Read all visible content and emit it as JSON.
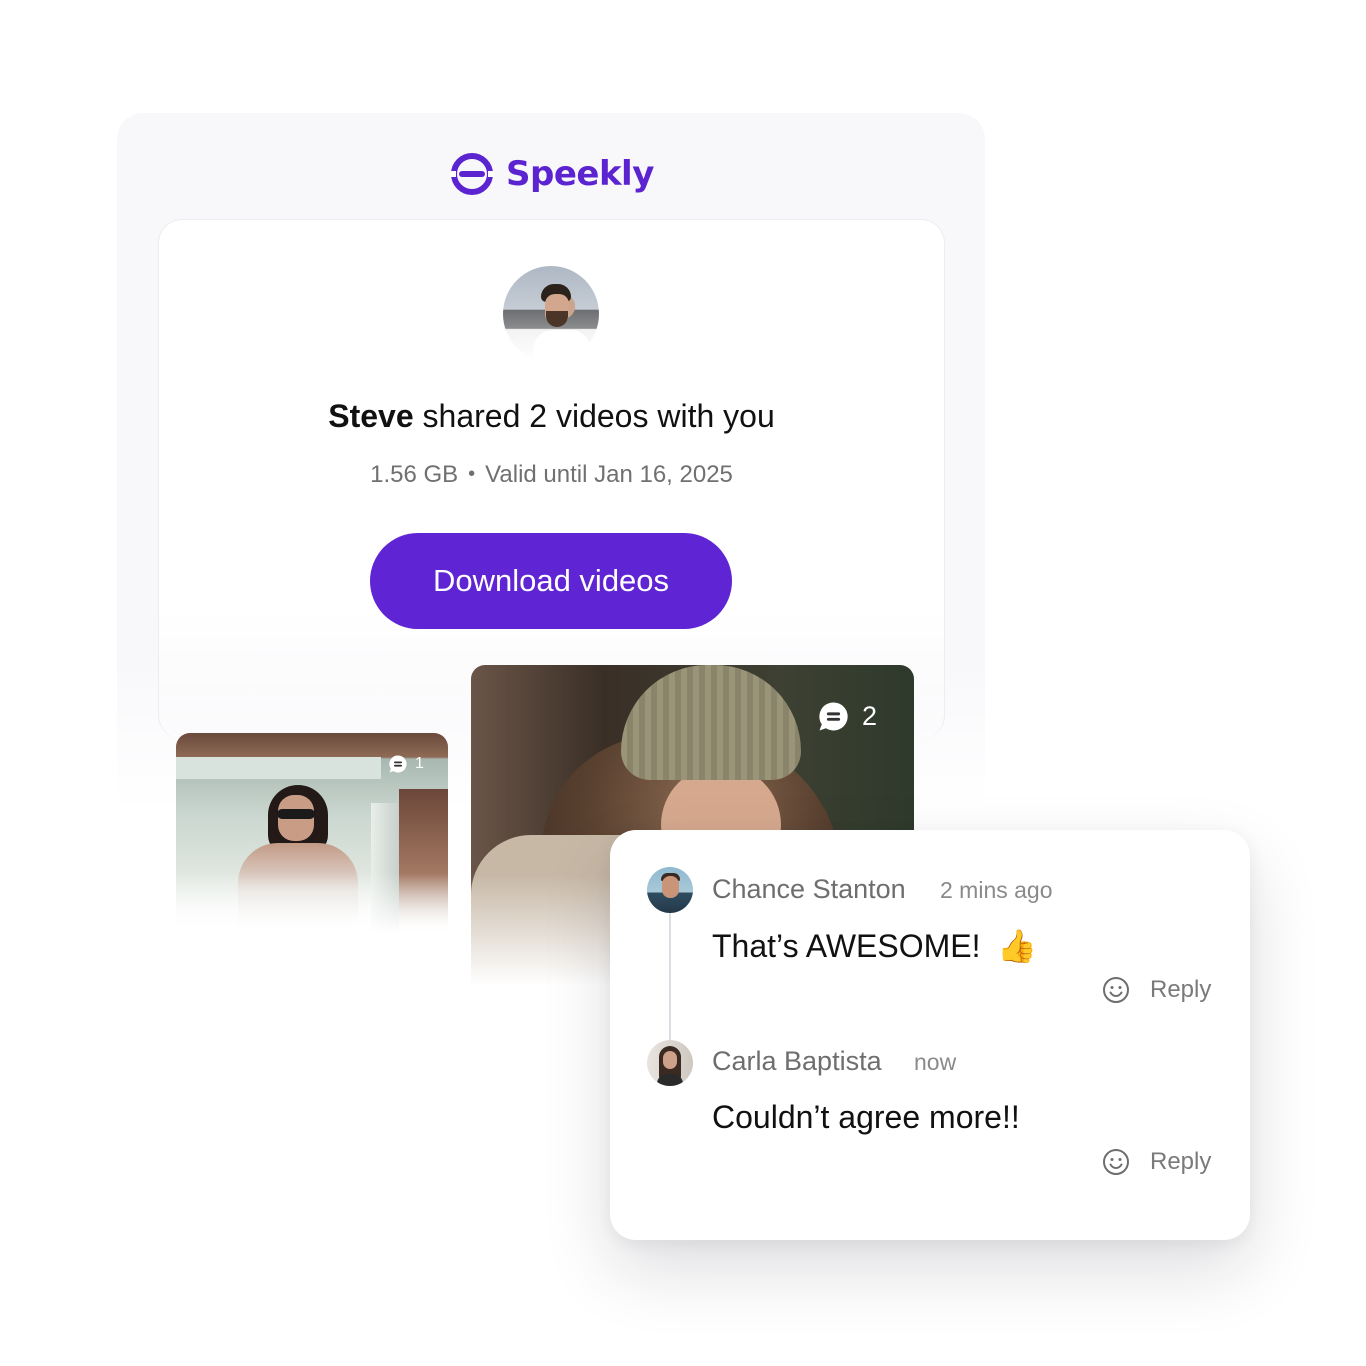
{
  "brand": {
    "name": "Speekly",
    "color": "#5b24d0"
  },
  "share": {
    "sender": "Steve",
    "message": "shared 2 videos with you",
    "size": "1.56 GB",
    "separator": "•",
    "validity": "Valid until Jan 16, 2025",
    "download_label": "Download videos",
    "button_color": "#5f24d3"
  },
  "videos": [
    {
      "comment_count": "1",
      "icon": "comment-bubble-icon"
    },
    {
      "comment_count": "2",
      "icon": "comment-bubble-icon"
    }
  ],
  "comments": [
    {
      "author": "Chance Stanton",
      "time": "2 mins ago",
      "text": "That’s AWESOME!",
      "emoji": "👍",
      "react_icon": "smile-icon",
      "reply_label": "Reply"
    },
    {
      "author": "Carla Baptista",
      "time": "now",
      "text": "Couldn’t agree more!!",
      "react_icon": "smile-icon",
      "reply_label": "Reply"
    }
  ]
}
